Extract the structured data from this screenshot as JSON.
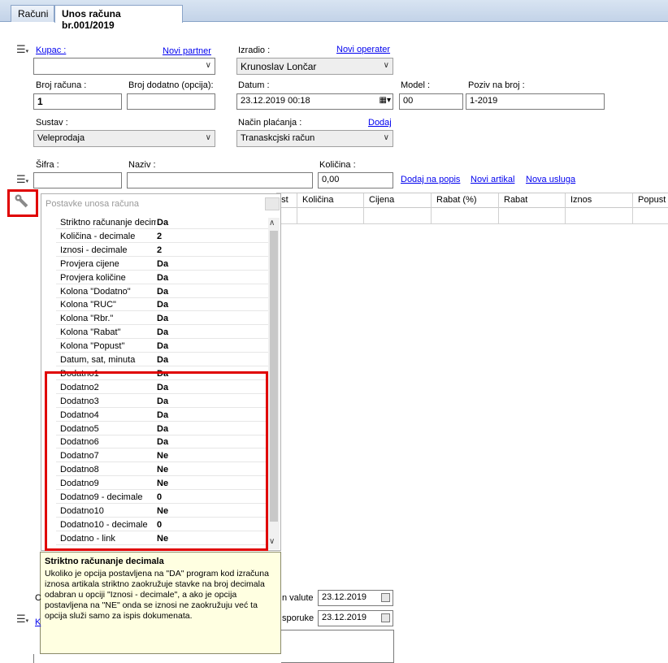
{
  "tabs": [
    {
      "label": "Računi"
    },
    {
      "label": "Unos računa br.001/2019"
    }
  ],
  "form": {
    "kupac_label": "Kupac :",
    "novi_partner": "Novi partner",
    "kupac_value": "",
    "izradio_label": "Izradio :",
    "novi_operater": "Novi operater",
    "izradio_value": "Krunoslav Lončar",
    "broj_racuna_label": "Broj računa :",
    "broj_racuna_value": "1",
    "broj_dodatno_label": "Broj dodatno (opcija):",
    "broj_dodatno_value": "",
    "datum_label": "Datum :",
    "datum_value": "23.12.2019 00:18",
    "model_label": "Model :",
    "model_value": "00",
    "poziv_label": "Poziv na broj :",
    "poziv_value": "1-2019",
    "sustav_label": "Sustav :",
    "sustav_value": "Veleprodaja",
    "nacin_label": "Način plaćanja :",
    "dodaj": "Dodaj",
    "nacin_value": "Tranaskcjski račun",
    "sifra_label": "Šifra :",
    "sifra_value": "",
    "naziv_label": "Naziv :",
    "naziv_value": "",
    "kolicina_label": "Količina :",
    "kolicina_value": "0,00",
    "dodaj_na_popis": "Dodaj na popis",
    "novi_artikal": "Novi artikal",
    "nova_usluga": "Nova usluga"
  },
  "grid": {
    "columns": [
      "ust",
      "Količina",
      "Cijena",
      "Rabat (%)",
      "Rabat",
      "Iznos",
      "Popust"
    ]
  },
  "panel": {
    "title": "Postavke unosa računa",
    "items": [
      {
        "key": "Striktno računanje decimala",
        "value": "Da"
      },
      {
        "key": "Količina - decimale",
        "value": "2"
      },
      {
        "key": "Iznosi - decimale",
        "value": "2"
      },
      {
        "key": "Provjera cijene",
        "value": "Da"
      },
      {
        "key": "Provjera količine",
        "value": "Da"
      },
      {
        "key": "Kolona \"Dodatno\"",
        "value": "Da"
      },
      {
        "key": "Kolona \"RUC\"",
        "value": "Da"
      },
      {
        "key": "Kolona \"Rbr.\"",
        "value": "Da"
      },
      {
        "key": "Kolona \"Rabat\"",
        "value": "Da"
      },
      {
        "key": "Kolona \"Popust\"",
        "value": "Da"
      },
      {
        "key": "Datum, sat, minuta",
        "value": "Da"
      },
      {
        "key": "Dodatno1",
        "value": "Da"
      },
      {
        "key": "Dodatno2",
        "value": "Da"
      },
      {
        "key": "Dodatno3",
        "value": "Da"
      },
      {
        "key": "Dodatno4",
        "value": "Da"
      },
      {
        "key": "Dodatno5",
        "value": "Da"
      },
      {
        "key": "Dodatno6",
        "value": "Da"
      },
      {
        "key": "Dodatno7",
        "value": "Ne"
      },
      {
        "key": "Dodatno8",
        "value": "Ne"
      },
      {
        "key": "Dodatno9",
        "value": "Ne"
      },
      {
        "key": "Dodatno9 - decimale",
        "value": "0"
      },
      {
        "key": "Dodatno10",
        "value": "Ne"
      },
      {
        "key": "Dodatno10 - decimale",
        "value": "0"
      },
      {
        "key": "Dodatno - link",
        "value": "Ne"
      }
    ]
  },
  "tooltip": {
    "title": "Striktno računanje decimala",
    "body": "Ukoliko je opcija postavljena na \"DA\" program kod izračuna iznosa artikala striktno zaokružuje stavke na broj decimala odabran u opciji \"Iznosi - decimale\", a ako je opcija postavljena na \"NE\" onda se iznosi ne zaokružuju već ta opcija služi samo za ispis dokumenata."
  },
  "bottom": {
    "c_label": "C",
    "k_link": "K",
    "valute_label": "n valute",
    "valute_value": "23.12.2019",
    "isporuke_label": "sporuke",
    "isporuke_value": "23.12.2019"
  },
  "colors": {
    "highlight": "#e00000",
    "tooltip_bg": "#ffffe1",
    "link": "#0000ee"
  }
}
